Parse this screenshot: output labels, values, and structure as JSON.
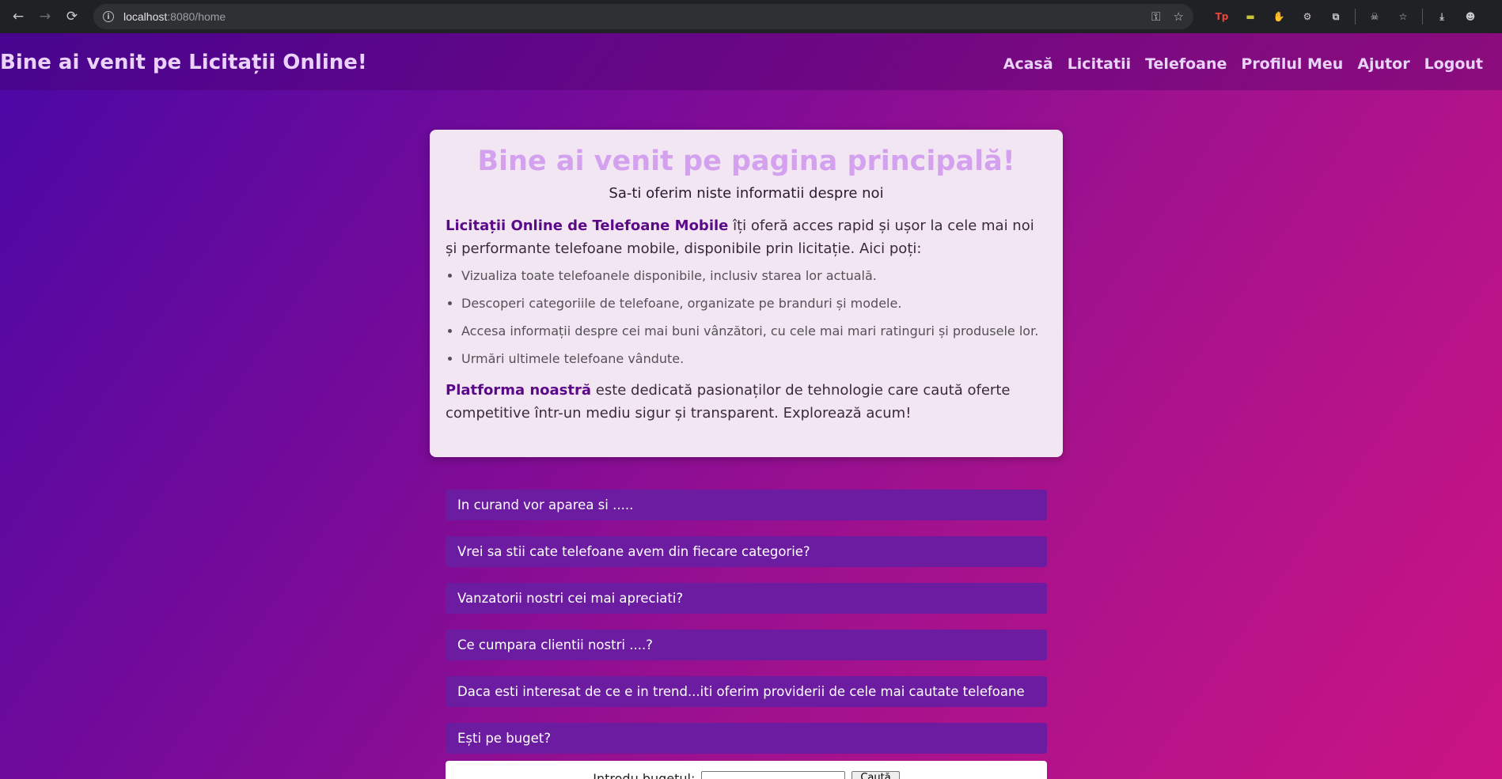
{
  "browser": {
    "back_icon": "←",
    "forward_icon": "→",
    "reload_icon": "⟳",
    "url_host": "localhost",
    "url_path": ":8080/home",
    "key_icon": "⚿",
    "star_icon": "☆",
    "extensions": [
      {
        "name": "tp",
        "glyph": "Tp",
        "color": "#e8453c"
      },
      {
        "name": "yellow",
        "glyph": "▬",
        "color": "#c9c13a"
      },
      {
        "name": "red-hand",
        "glyph": "✋",
        "color": "#e53935"
      },
      {
        "name": "gear",
        "glyph": "⚙",
        "color": "#d0d0d0"
      },
      {
        "name": "puzzle",
        "glyph": "⧉",
        "color": "#c8cacd"
      }
    ],
    "incognito_icon": "☠",
    "bookmark_icon": "☆",
    "download_icon": "⤓",
    "profile_icon": "☻"
  },
  "site": {
    "title": "Bine ai venit pe Licitații Online!",
    "nav": [
      "Acasă",
      "Licitatii",
      "Telefoane",
      "Profilul Meu",
      "Ajutor",
      "Logout"
    ]
  },
  "welcome": {
    "heading": "Bine ai venit pe pagina principală!",
    "subtitle": "Sa-ti oferim niste informatii despre noi",
    "intro_bold": "Licitații Online de Telefoane Mobile",
    "intro_rest": " îți oferă acces rapid și ușor la cele mai noi și performante telefoane mobile, disponibile prin licitație. Aici poți:",
    "bullets": [
      "Vizualiza toate telefoanele disponibile, inclusiv starea lor actuală.",
      "Descoperi categoriile de telefoane, organizate pe branduri și modele.",
      "Accesa informații despre cei mai buni vânzători, cu cele mai mari ratinguri și produsele lor.",
      "Urmări ultimele telefoane vândute."
    ],
    "outro_bold": "Platforma noastră",
    "outro_rest": " este dedicată pasionaților de tehnologie care caută oferte competitive într-un mediu sigur și transparent. Explorează acum!"
  },
  "accordion": [
    "In curand vor aparea si .....",
    "Vrei sa stii cate telefoane avem din fiecare categorie?",
    "Vanzatorii nostri cei mai apreciati?",
    "Ce cumpara clientii nostri ....?",
    "Daca esti interesat de ce e in trend...iti oferim providerii de cele mai cautate telefoane",
    "Ești pe buget?"
  ],
  "budget": {
    "label": "Introdu bugetul:",
    "button": "Caută"
  }
}
